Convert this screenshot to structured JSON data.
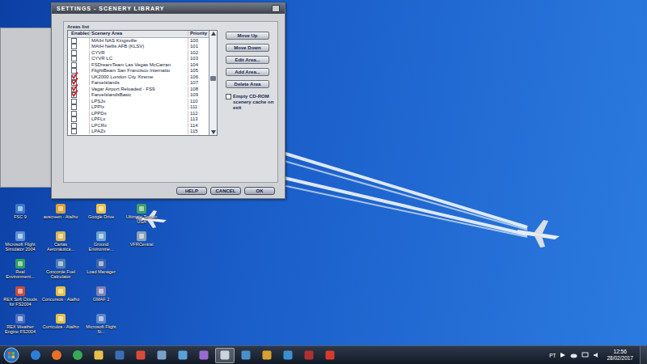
{
  "dialog": {
    "title": "SETTINGS - SCENERY LIBRARY",
    "list_label": "Areas list",
    "columns": [
      "Enabled",
      "Scenery Area",
      "Priority"
    ],
    "rows": [
      {
        "name": "MAIH NAS Kingsville",
        "priority": "100",
        "enabled": false
      },
      {
        "name": "MAIH Nellis AFB (KLSV)",
        "priority": "101",
        "enabled": false
      },
      {
        "name": "CYVR",
        "priority": "102",
        "enabled": false
      },
      {
        "name": "CYVR LC",
        "priority": "103",
        "enabled": false
      },
      {
        "name": "FSDreamTeam Las Vegas McCarran",
        "priority": "104",
        "enabled": false
      },
      {
        "name": "FlightBeam San Francisco Internatio",
        "priority": "105",
        "enabled": false
      },
      {
        "name": "UK2000 London City Xtreme",
        "priority": "106",
        "enabled": true
      },
      {
        "name": "FaroeIslands",
        "priority": "107",
        "enabled": true
      },
      {
        "name": "Vagar Airport Reloaded - FS9",
        "priority": "108",
        "enabled": true
      },
      {
        "name": "FaroeIslandsBasic",
        "priority": "109",
        "enabled": true
      },
      {
        "name": "LPSJx",
        "priority": "110",
        "enabled": false
      },
      {
        "name": "LPPIx",
        "priority": "111",
        "enabled": false
      },
      {
        "name": "LPPDx",
        "priority": "112",
        "enabled": false
      },
      {
        "name": "LPFLx",
        "priority": "113",
        "enabled": false
      },
      {
        "name": "LPCRx",
        "priority": "114",
        "enabled": false
      },
      {
        "name": "LPAZx",
        "priority": "115",
        "enabled": false
      }
    ],
    "scrollbar": {
      "level": 0.45
    },
    "side_buttons": [
      "Move Up",
      "Move Down",
      "Edit Area...",
      "Add Area...",
      "Delete Area"
    ],
    "cache_option": {
      "label": "Empty CD-ROM scenery cache on exit",
      "checked": false
    },
    "buttons": [
      "HELP",
      "CANCEL",
      "OK"
    ]
  },
  "desktop_icons": [
    {
      "label": "FSC 9"
    },
    {
      "label": "Microsoft Flight Simulator 2004"
    },
    {
      "label": "Real Environment..."
    },
    {
      "label": "REX Soft Clouds for FS2004"
    },
    {
      "label": "REX Weather Engine FS2004"
    },
    {
      "label": "avscreen - Atalho"
    },
    {
      "label": "Cartas Aeronáutica..."
    },
    {
      "label": "Concorde Fuel Calculator"
    },
    {
      "label": "Concursos - Atalho"
    },
    {
      "label": "Curriculos - Atalho"
    },
    {
      "label": "Google Drive"
    },
    {
      "label": "Ground Environme..."
    },
    {
      "label": "Load Manager"
    },
    {
      "label": "GMAF 2"
    },
    {
      "label": "Microsoft Flight Si..."
    },
    {
      "label": "Ultimate Terrain USA"
    },
    {
      "label": "VFRCentral"
    }
  ],
  "taskbar": {
    "apps": [
      {
        "active": false
      },
      {
        "active": false
      },
      {
        "active": false
      },
      {
        "active": false
      },
      {
        "active": false
      },
      {
        "active": false
      },
      {
        "active": false
      },
      {
        "active": false
      },
      {
        "active": false
      },
      {
        "active": true
      },
      {
        "active": false
      },
      {
        "active": false
      },
      {
        "active": false
      },
      {
        "active": false
      },
      {
        "active": false
      }
    ],
    "language": "PT",
    "time": "12:56",
    "date": "28/02/2017"
  }
}
